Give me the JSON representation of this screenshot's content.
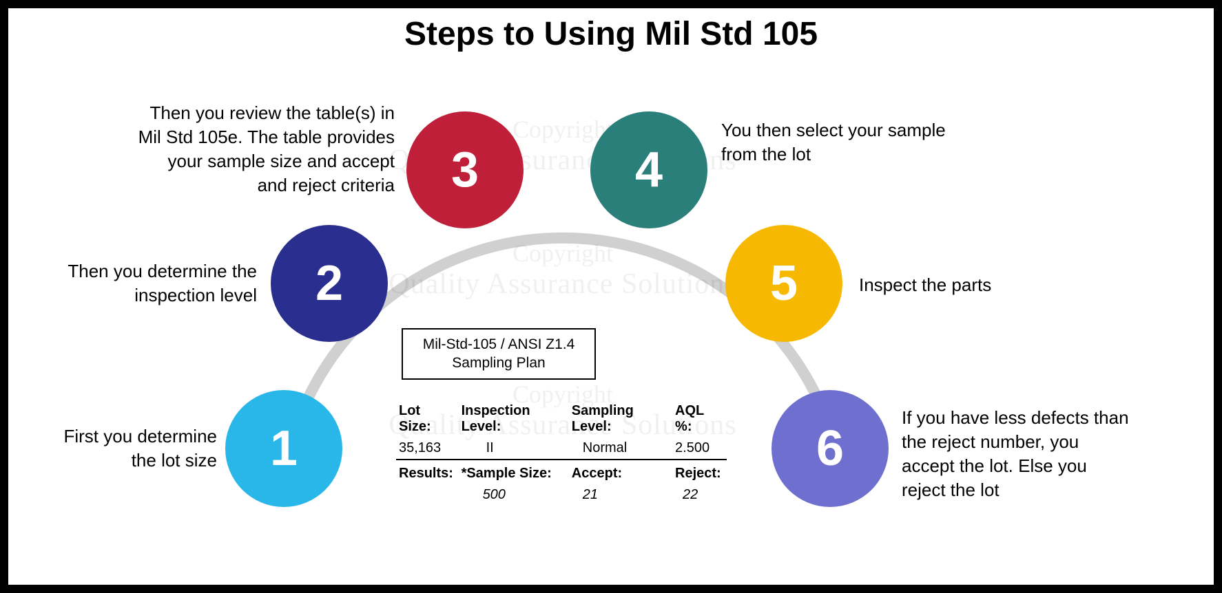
{
  "title": "Steps to Using Mil Std 105",
  "steps": [
    {
      "num": "1",
      "label": "First you determine the lot size"
    },
    {
      "num": "2",
      "label": "Then you determine the inspection level"
    },
    {
      "num": "3",
      "label": "Then you review the table(s) in Mil Std 105e. The table provides your sample size and accept and reject criteria"
    },
    {
      "num": "4",
      "label": "You then select your sample from the lot"
    },
    {
      "num": "5",
      "label": "Inspect the parts"
    },
    {
      "num": "6",
      "label": "If you have less defects than the reject number, you accept the lot. Else you reject the lot"
    }
  ],
  "colors": {
    "step1": "#29b6e8",
    "step2": "#2a2f8f",
    "step3": "#bf1f38",
    "step4": "#2a7f7a",
    "step5": "#f6b800",
    "step6": "#6f6fcf"
  },
  "panel": {
    "title": "Mil-Std-105 / ANSI Z1.4 Sampling Plan",
    "row1": {
      "lot_size_label": "Lot Size:",
      "lot_size": "35,163",
      "inspection_level_label": "Inspection Level:",
      "inspection_level": "II",
      "sampling_level_label": "Sampling Level:",
      "sampling_level": "Normal",
      "aql_label": "AQL %:",
      "aql": "2.500"
    },
    "row2": {
      "results_label": "Results:",
      "sample_size_label": "*Sample Size:",
      "sample_size": "500",
      "accept_label": "Accept:",
      "accept": "21",
      "reject_label": "Reject:",
      "reject": "22"
    }
  },
  "watermark": {
    "top": "Copyright",
    "bottom": "Quality Assurance Solutions"
  }
}
